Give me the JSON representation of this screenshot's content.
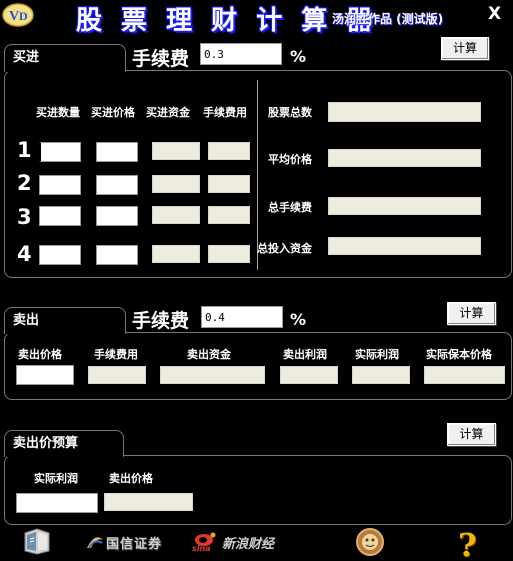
{
  "header": {
    "title": "股 票 理 财 计 算 器",
    "subtitle": "汤润胜作品 (测试版)",
    "close_label": "X"
  },
  "buy": {
    "section_label": "买进",
    "fee_label": "手续费",
    "fee_rate": "0.3",
    "pct_sign": "%",
    "calc_label": "计算",
    "col_headers": [
      "买进数量",
      "买进价格",
      "买进资金",
      "手续费用"
    ],
    "row_numbers": [
      "1",
      "2",
      "3",
      "4"
    ],
    "summary_labels": [
      "股票总数",
      "平均价格",
      "总手续费",
      "总投入资金"
    ]
  },
  "sell": {
    "section_label": "卖出",
    "fee_label": "手续费",
    "fee_rate": "0.4",
    "pct_sign": "%",
    "calc_label": "计算",
    "col_headers": [
      "卖出价格",
      "手续费用",
      "卖出资金",
      "卖出利润",
      "实际利润",
      "实际保本价格"
    ]
  },
  "budget": {
    "section_label": "卖出价预算",
    "calc_label": "计算",
    "col_headers": [
      "实际利润",
      "卖出价格"
    ]
  },
  "footer": {
    "guosen": "国信证券",
    "sina": "新浪财经",
    "sina_mark": "sina",
    "help": "?"
  },
  "colors": {
    "background": "#000000",
    "title_outline": "#1a1aff",
    "readonly_field": "#eeecdf",
    "border": "#777777"
  },
  "icons": [
    "app-logo-icon",
    "book-icon",
    "guosen-logo-icon",
    "sina-logo-icon",
    "emblem-icon",
    "help-icon"
  ]
}
